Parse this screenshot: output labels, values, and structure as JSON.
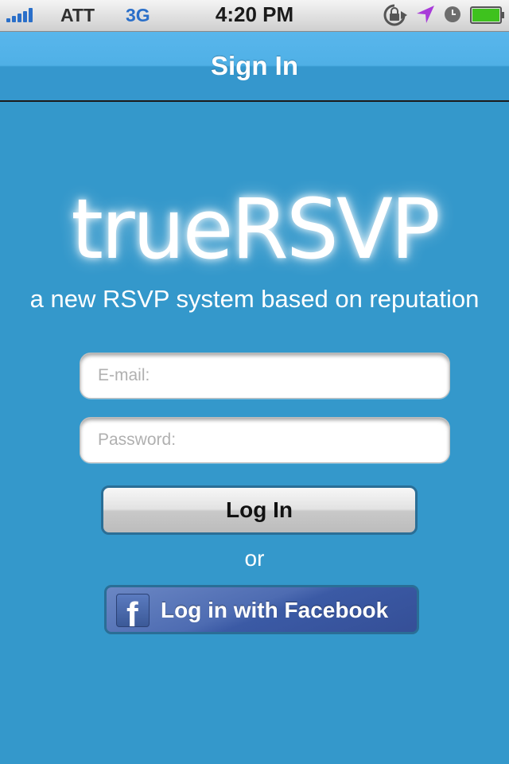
{
  "status_bar": {
    "carrier": "ATT",
    "network": "3G",
    "time": "4:20 PM",
    "icons": [
      "signal-bars-icon",
      "rotation-lock-icon",
      "location-arrow-icon",
      "alarm-clock-icon",
      "battery-icon"
    ],
    "battery_color": "#3ec21e",
    "location_color": "#a83ad9"
  },
  "nav": {
    "title": "Sign In"
  },
  "brand": {
    "logo": "trueRSVP",
    "tagline": "a new RSVP system based on reputation"
  },
  "form": {
    "email_placeholder": "E-mail:",
    "email_value": "",
    "password_placeholder": "Password:",
    "password_value": "",
    "login_label": "Log In",
    "or_label": "or",
    "facebook_label": "Log in with Facebook",
    "facebook_glyph": "f"
  },
  "colors": {
    "background": "#3498cb",
    "nav_highlight": "#59b6ec",
    "facebook": "#3b5998",
    "button_border": "#2a6e96"
  }
}
